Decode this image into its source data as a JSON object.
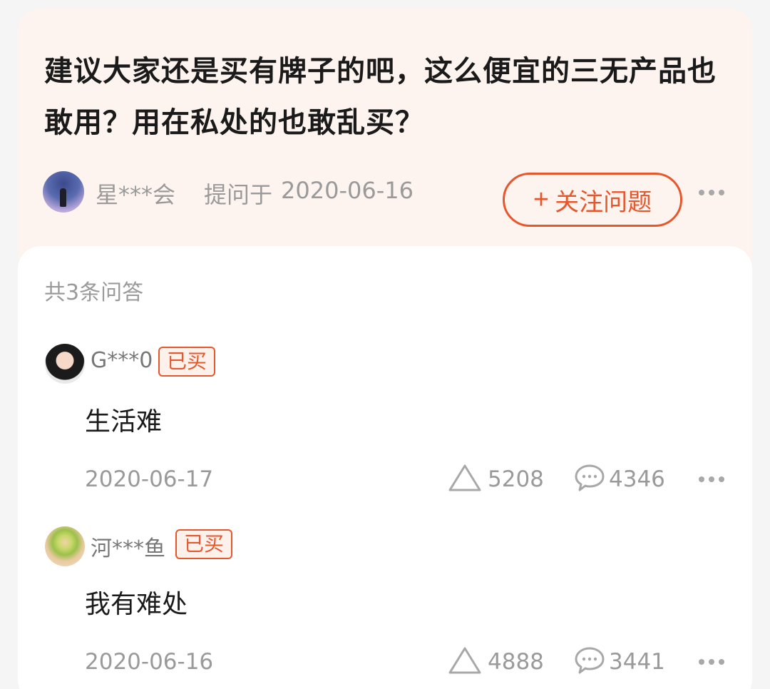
{
  "question": {
    "title": "建议大家还是买有牌子的吧，这么便宜的三无产品也敢用？用在私处的也敢乱买？",
    "asker_name": "星***会",
    "ask_label": "提问于",
    "ask_date": "2020-06-16",
    "follow_label": "关注问题",
    "follow_icon": "plus-icon",
    "more_icon": "more-dots-icon"
  },
  "answers_section": {
    "count_label": "共3条问答"
  },
  "answers": [
    {
      "user": "G***0",
      "badge": "已买",
      "text": "生活难",
      "date": "2020-06-17",
      "likes": "5208",
      "comments": "4346"
    },
    {
      "user": "河***鱼",
      "badge": "已买",
      "text": "我有难处",
      "date": "2020-06-16",
      "likes": "4888",
      "comments": "3441"
    }
  ],
  "colors": {
    "accent": "#e8572c",
    "question_bg": "#fdf3ef",
    "muted_text": "#9a9a9a"
  }
}
